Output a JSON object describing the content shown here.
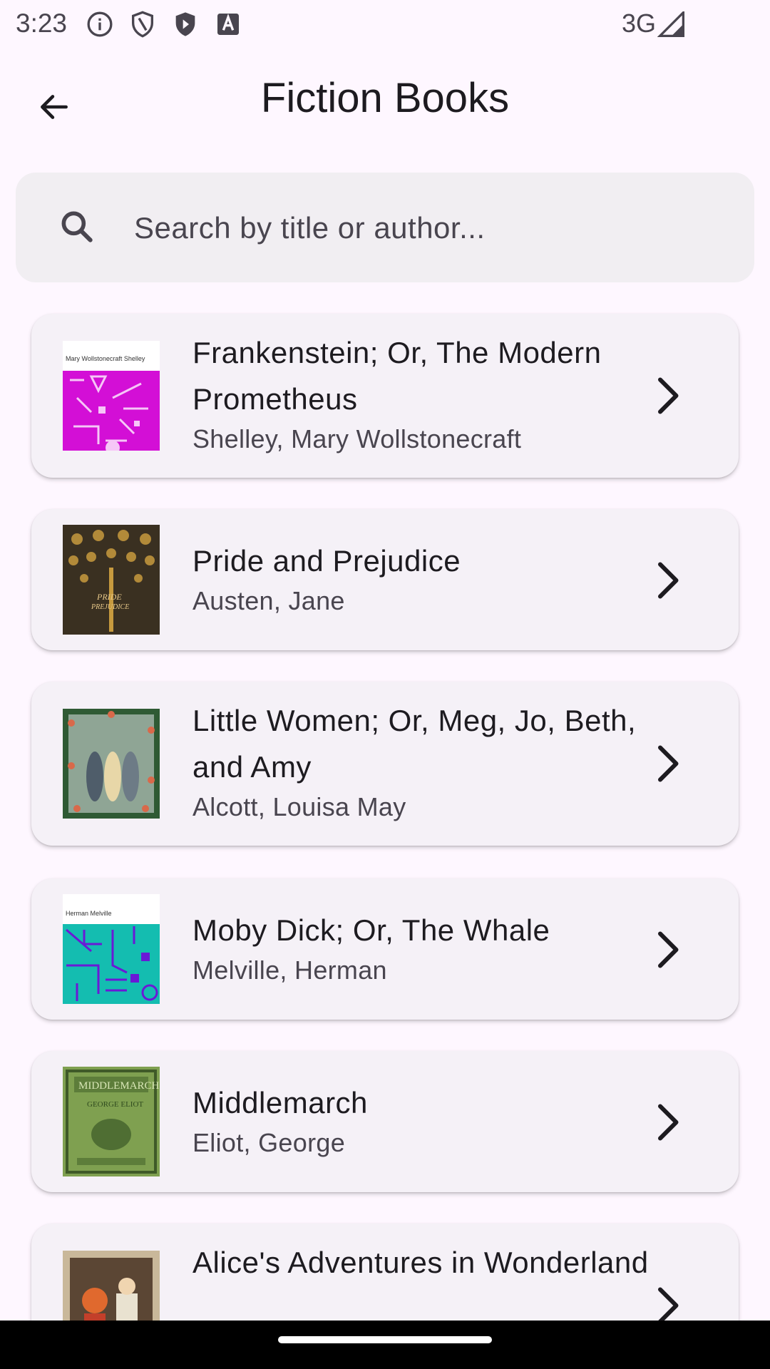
{
  "status_bar": {
    "time": "3:23",
    "network": "3G",
    "icons": [
      "info-icon",
      "shield-outline-icon",
      "shield-play-icon",
      "text-a-icon",
      "signal-icon"
    ]
  },
  "app_bar": {
    "title": "Fiction Books",
    "back_icon": "arrow-back-icon"
  },
  "search": {
    "placeholder": "Search by title or author...",
    "value": ""
  },
  "books": [
    {
      "title": "Frankenstein; Or, The Modern Prometheus",
      "author": "Shelley, Mary Wollstonecraft",
      "cover_label": "Mary Wollstonecraft Shelley",
      "cover_color": "#d30fd6"
    },
    {
      "title": "Pride and Prejudice",
      "author": "Austen, Jane",
      "cover_color": "#3a3021"
    },
    {
      "title": "Little Women; Or, Meg, Jo, Beth, and Amy",
      "author": "Alcott, Louisa May",
      "cover_color": "#8fa595"
    },
    {
      "title": "Moby Dick; Or, The Whale",
      "author": "Melville, Herman",
      "cover_label": "Herman Melville",
      "cover_color": "#14bdb0"
    },
    {
      "title": "Middlemarch",
      "author": "Eliot, George",
      "cover_color": "#7fa050"
    },
    {
      "title": "Alice's Adventures in Wonderland",
      "author": "",
      "cover_color": "#c9b89a"
    }
  ],
  "colors": {
    "background": "#fef7ff",
    "card": "#f5f1f7",
    "search_bg": "#f1eef2",
    "text_primary": "#1d1b20",
    "text_secondary": "#49454f"
  }
}
